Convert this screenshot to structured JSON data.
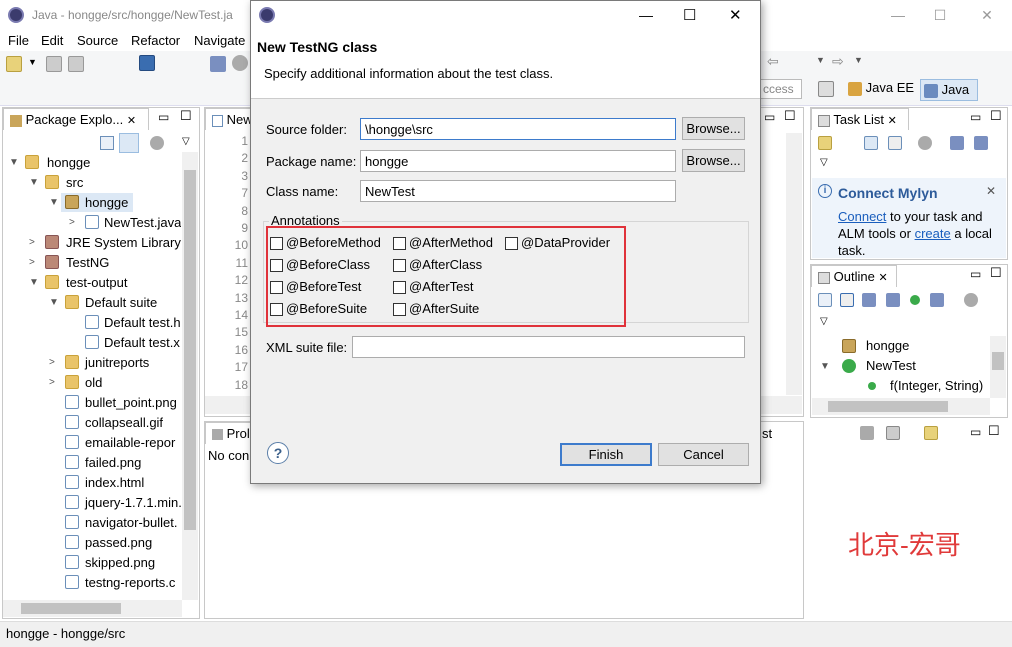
{
  "window": {
    "title": "Java - hongge/src/hongge/NewTest.ja",
    "menu": [
      "File",
      "Edit",
      "Source",
      "Refactor",
      "Navigate"
    ],
    "quick_access": "ccess",
    "perspectives": [
      "Java EE",
      "Java"
    ]
  },
  "package_explorer": {
    "tab_label": "Package Explo...",
    "items": [
      {
        "label": "hongge"
      },
      {
        "label": "src"
      },
      {
        "label": "hongge"
      },
      {
        "label": "NewTest.java"
      },
      {
        "label": "JRE System Library"
      },
      {
        "label": "TestNG"
      },
      {
        "label": "test-output"
      },
      {
        "label": "Default suite"
      },
      {
        "label": "Default test.h"
      },
      {
        "label": "Default test.x"
      },
      {
        "label": "junitreports"
      },
      {
        "label": "old"
      },
      {
        "label": "bullet_point.png"
      },
      {
        "label": "collapseall.gif"
      },
      {
        "label": "emailable-repor"
      },
      {
        "label": "failed.png"
      },
      {
        "label": "index.html"
      },
      {
        "label": "jquery-1.7.1.min."
      },
      {
        "label": "navigator-bullet."
      },
      {
        "label": "passed.png"
      },
      {
        "label": "skipped.png"
      },
      {
        "label": "testng-reports.c"
      }
    ]
  },
  "editor": {
    "tab_label": "New",
    "line_numbers": [
      "1",
      "2",
      "3",
      "7",
      "8",
      "9",
      "10",
      "11",
      "12",
      "13",
      "14",
      "15",
      "16",
      "17",
      "18"
    ]
  },
  "problems": {
    "tab_label": "Prol",
    "text": "No con",
    "right_tab": "st"
  },
  "task_list": {
    "tab_label": "Task List"
  },
  "mylyn": {
    "title": "Connect Mylyn",
    "connect_link": "Connect",
    "text1": " to your task and",
    "text2": "ALM tools or ",
    "create_link": "create",
    "text3": " a local",
    "text4": "task."
  },
  "outline": {
    "tab_label": "Outline",
    "items": [
      {
        "label": "hongge"
      },
      {
        "label": "NewTest"
      },
      {
        "label": "f(Integer, String)"
      }
    ]
  },
  "status": "hongge - hongge/src",
  "watermark": "北京-宏哥",
  "dialog": {
    "title": "New TestNG class",
    "subtitle": "Specify additional information about the test class.",
    "source_folder_label": "Source folder:",
    "source_folder_value": "\\hongge\\src",
    "package_label": "Package name:",
    "package_value": "hongge",
    "class_label": "Class name:",
    "class_value": "NewTest",
    "browse": "Browse...",
    "annotations_label": "Annotations",
    "annotations": {
      "before_method": "@BeforeMethod",
      "after_method": "@AfterMethod",
      "data_provider": "@DataProvider",
      "before_class": "@BeforeClass",
      "after_class": "@AfterClass",
      "before_test": "@BeforeTest",
      "after_test": "@AfterTest",
      "before_suite": "@BeforeSuite",
      "after_suite": "@AfterSuite"
    },
    "xml_label": "XML suite file:",
    "xml_value": "",
    "help": "?",
    "finish": "Finish",
    "cancel": "Cancel"
  }
}
